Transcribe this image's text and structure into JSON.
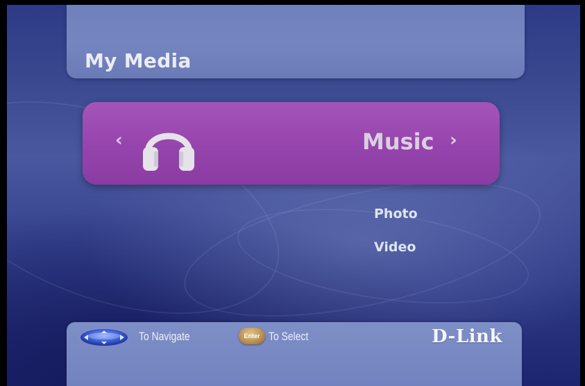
{
  "header": {
    "title": "My Media"
  },
  "carousel": {
    "selected_label": "Music",
    "selected_icon": "headphones-icon",
    "prev_icon": "chevron-left-icon",
    "next_icon": "chevron-right-icon",
    "prev_glyph": "‹",
    "next_glyph": "›",
    "highlight_color": "#9a48b0"
  },
  "menu": {
    "items": [
      {
        "label": "Photo"
      },
      {
        "label": "Video"
      }
    ]
  },
  "footer": {
    "navigate_icon": "directional-pad-icon",
    "navigate_hint": "To Navigate",
    "enter_icon": "enter-button-icon",
    "enter_label": "Enter",
    "select_hint": "To Select",
    "brand": "D-Link"
  },
  "colors": {
    "background": "#3a4890",
    "panel": "#7485c0",
    "text": "#ececf4"
  }
}
